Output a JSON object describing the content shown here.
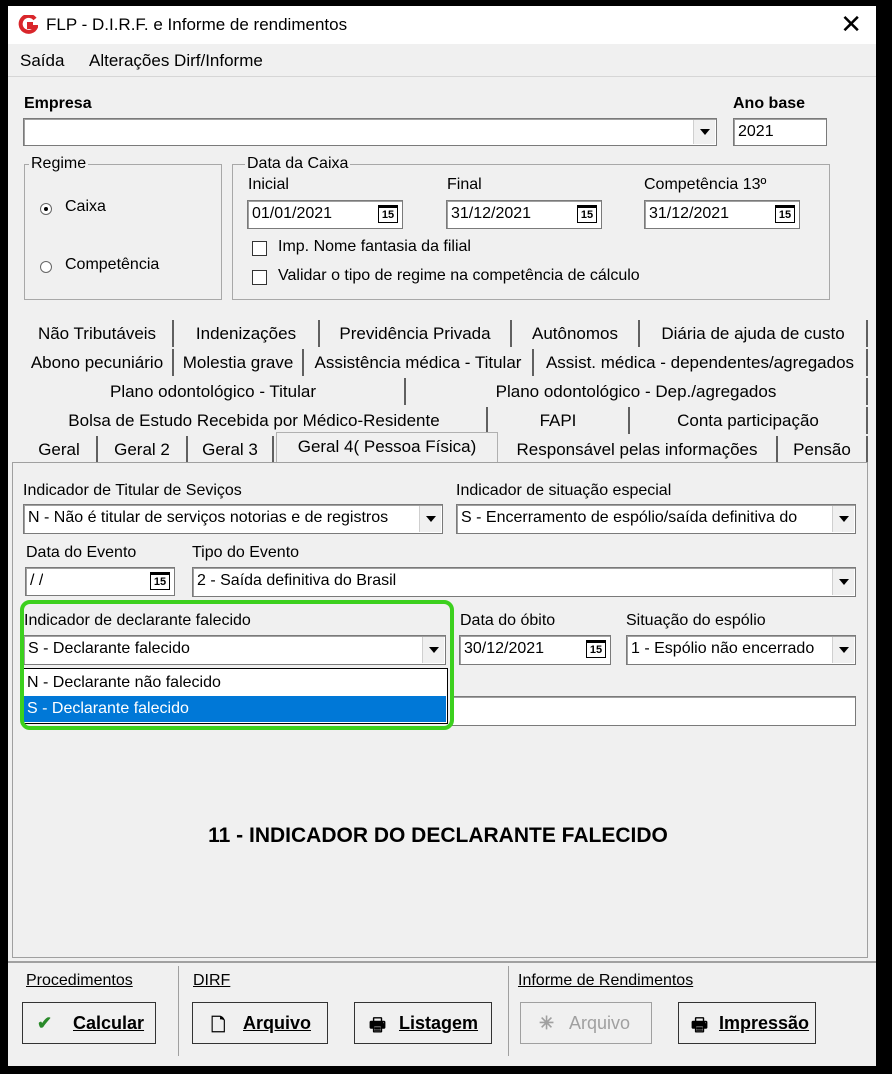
{
  "window": {
    "title": "FLP - D.I.R.F. e Informe de rendimentos",
    "close": "✕"
  },
  "menu": [
    "Saída",
    "Alterações Dirf/Informe"
  ],
  "empresa": {
    "label": "Empresa",
    "value": ""
  },
  "ano_base": {
    "label": "Ano base",
    "value": "2021"
  },
  "regime": {
    "title": "Regime",
    "options": [
      "Caixa",
      "Competência"
    ],
    "selected": "Caixa"
  },
  "data_caixa": {
    "title": "Data da Caixa",
    "inicial_label": "Inicial",
    "inicial": "01/01/2021",
    "final_label": "Final",
    "final": "31/12/2021",
    "comp13_label": "Competência 13º",
    "comp13": "31/12/2021",
    "check1": "Imp. Nome fantasia da filial",
    "check2": "Validar o tipo de regime na competência de cálculo"
  },
  "tabs": {
    "row1": [
      "Não Tributáveis",
      "Indenizações",
      "Previdência Privada",
      "Autônomos",
      "Diária de ajuda de custo"
    ],
    "row2": [
      "Abono pecuniário",
      "Molestia grave",
      "Assistência médica - Titular",
      "Assist. médica - dependentes/agregados"
    ],
    "row3": [
      "Plano odontológico - Titular",
      "Plano odontológico - Dep./agregados"
    ],
    "row4": [
      "Bolsa de Estudo Recebida por Médico-Residente",
      "FAPI",
      "Conta participação"
    ],
    "row5": [
      "Geral",
      "Geral 2",
      "Geral 3",
      "Geral 4( Pessoa Física)",
      "Responsável pelas informações",
      "Pensão"
    ],
    "active": "Geral 4( Pessoa Física)"
  },
  "form": {
    "titular_label": "Indicador de Titular de Seviços",
    "titular_value": "N - Não é titular de serviços notorias e de registros",
    "situacao_label": "Indicador de situação especial",
    "situacao_value": "S - Encerramento de espólio/saída definitiva do",
    "data_evento_label": "Data do Evento",
    "data_evento_value": " / /",
    "tipo_evento_label": "Tipo do Evento",
    "tipo_evento_value": "2 - Saída definitiva do Brasil",
    "falecido_label": "Indicador de declarante falecido",
    "falecido_value": "S - Declarante falecido",
    "falecido_options": [
      "N - Declarante não falecido",
      "S - Declarante falecido"
    ],
    "data_obito_label": "Data do óbito",
    "data_obito_value": "30/12/2021",
    "espolio_label": "Situação do espólio",
    "espolio_value": "1 - Espólio não encerrado"
  },
  "caption": "11 - INDICADOR DO DECLARANTE FALECIDO",
  "footer": {
    "procedimentos": "Procedimentos",
    "dirf": "DIRF",
    "informe": "Informe de Rendimentos",
    "calcular": "Calcular",
    "arquivo": "Arquivo",
    "listagem": "Listagem",
    "arquivo2": "Arquivo",
    "impressao": "Impressão"
  },
  "calendar_icon_text": "15",
  "colors": {
    "highlight": "#3cd01e",
    "selection": "#0078d7",
    "logo": "#d9262b"
  }
}
